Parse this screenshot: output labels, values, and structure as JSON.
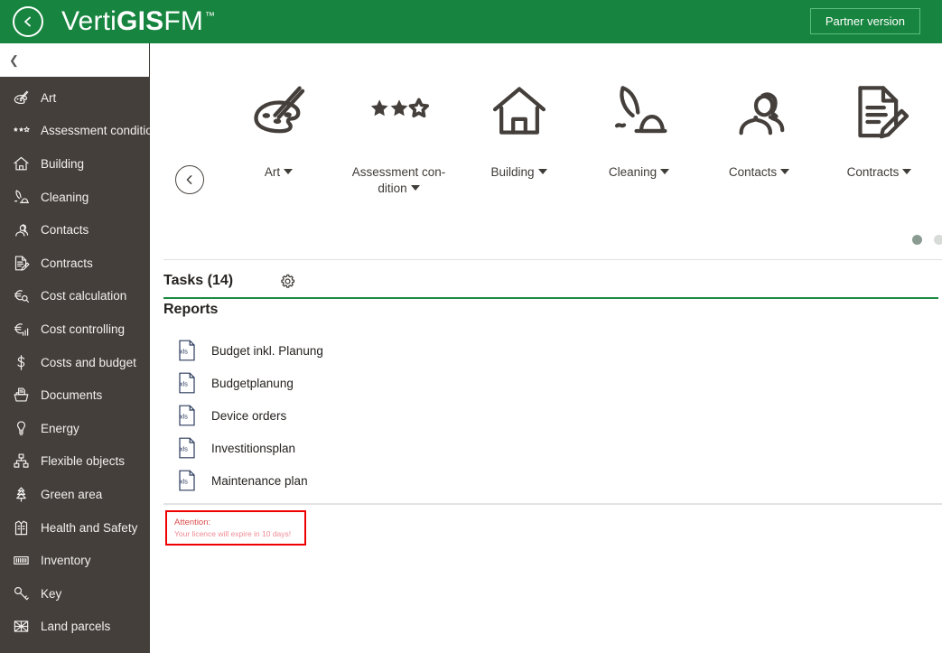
{
  "header": {
    "back_icon": "chevron-left-circle-icon",
    "brand_prefix": "Verti",
    "brand_bold": "GIS",
    "brand_suffix": " FM",
    "brand_tm": "™",
    "partner_button": "Partner version",
    "bg_color": "#17853f",
    "partner_border_color": "#5bbd80"
  },
  "sidebar": {
    "collapse_icon": "chevron-left-icon",
    "bg_color": "#443f3b",
    "items": [
      {
        "label": "Art",
        "icon": "palette-icon"
      },
      {
        "label": "Assessment condition",
        "icon": "stars-icon"
      },
      {
        "label": "Building",
        "icon": "home-icon"
      },
      {
        "label": "Cleaning",
        "icon": "vacuum-icon"
      },
      {
        "label": "Contacts",
        "icon": "people-icon"
      },
      {
        "label": "Contracts",
        "icon": "document-pencil-icon"
      },
      {
        "label": "Cost calculation",
        "icon": "euro-magnifier-icon"
      },
      {
        "label": "Cost controlling",
        "icon": "euro-chart-icon"
      },
      {
        "label": "Costs and budget",
        "icon": "dollar-icon"
      },
      {
        "label": "Documents",
        "icon": "documents-icon"
      },
      {
        "label": "Energy",
        "icon": "lightbulb-icon"
      },
      {
        "label": "Flexible objects",
        "icon": "hierarchy-icon"
      },
      {
        "label": "Green area",
        "icon": "tree-icon"
      },
      {
        "label": "Health and Safety",
        "icon": "safety-vest-icon"
      },
      {
        "label": "Inventory",
        "icon": "inventory-icon"
      },
      {
        "label": "Key",
        "icon": "key-icon"
      },
      {
        "label": "Land parcels",
        "icon": "land-parcel-icon"
      }
    ]
  },
  "carousel": {
    "back_icon": "chevron-left-circle-icon",
    "tiles": [
      {
        "label": "Art",
        "icon": "palette-icon",
        "has_caret": true
      },
      {
        "label": "Assessment con-\ndition",
        "icon": "stars-icon",
        "has_caret": true
      },
      {
        "label": "Building",
        "icon": "home-icon",
        "has_caret": true
      },
      {
        "label": "Cleaning",
        "icon": "vacuum-icon",
        "has_caret": true
      },
      {
        "label": "Contacts",
        "icon": "people-icon",
        "has_caret": true
      },
      {
        "label": "Contracts",
        "icon": "document-pencil-icon",
        "has_caret": true
      }
    ],
    "dots": [
      {
        "active": true,
        "color": "#8a9b91"
      },
      {
        "active": false,
        "color": "#d7dcd8"
      }
    ]
  },
  "tasks": {
    "title": "Tasks (14)",
    "settings_icon": "gear-icon",
    "accent_color": "#1d8a43"
  },
  "reports": {
    "title": "Reports",
    "items": [
      {
        "label": "Budget inkl. Planung",
        "icon": "xls-file-icon"
      },
      {
        "label": "Budgetplanung",
        "icon": "xls-file-icon"
      },
      {
        "label": "Device orders",
        "icon": "xls-file-icon"
      },
      {
        "label": "Investitionsplan",
        "icon": "xls-file-icon"
      },
      {
        "label": "Maintenance plan",
        "icon": "xls-file-icon"
      }
    ]
  },
  "warning": {
    "title": "Attention:",
    "message": "Your licence will expire in 10 days!",
    "border_color": "#ee0000",
    "title_color": "#d94b4b",
    "text_color": "#ef8b93"
  }
}
